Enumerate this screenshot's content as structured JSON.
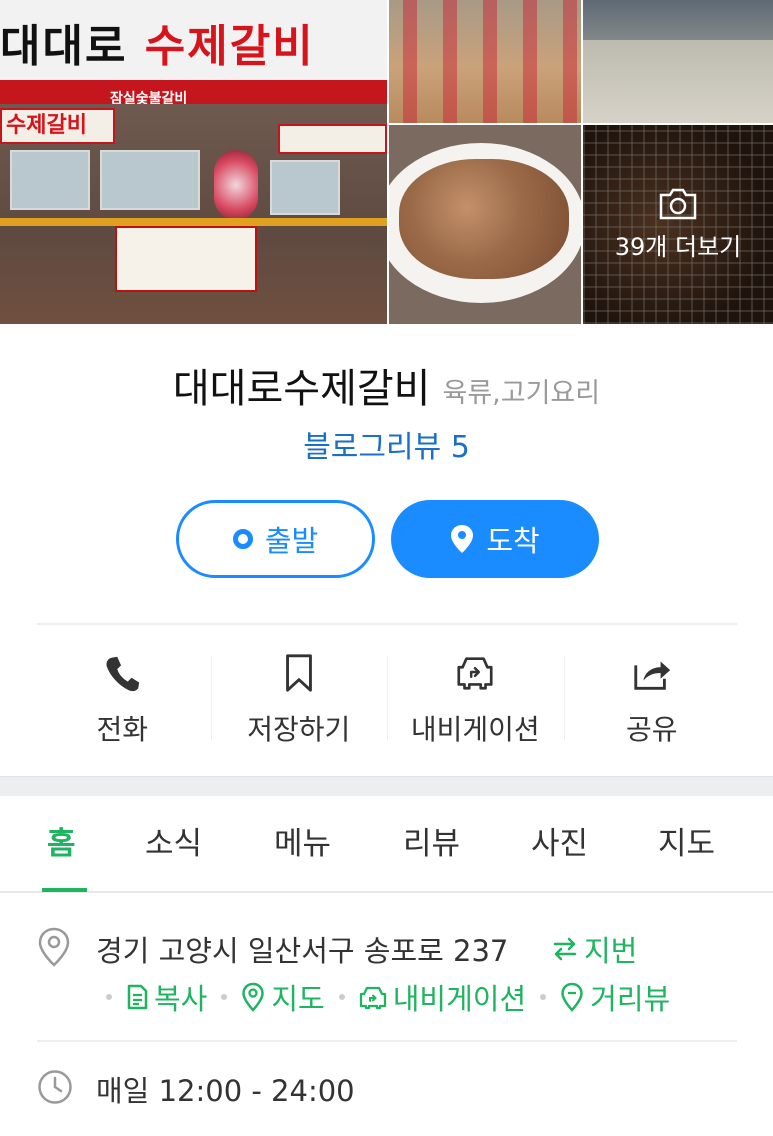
{
  "photos": {
    "main_sign_text_black": "대대로 ",
    "main_sign_text_red": "수제갈비",
    "band_text": "잠실숯불갈비",
    "side_sign_text": "수제갈비",
    "more_label": "39개 더보기"
  },
  "place": {
    "name": "대대로수제갈비",
    "category": "육류,고기요리",
    "blog_review": "블로그리뷰 5"
  },
  "buttons": {
    "start": "출발",
    "arrive": "도착"
  },
  "actions": [
    {
      "label": "전화",
      "icon": "phone-icon"
    },
    {
      "label": "저장하기",
      "icon": "bookmark-icon"
    },
    {
      "label": "내비게이션",
      "icon": "navigation-car-icon"
    },
    {
      "label": "공유",
      "icon": "share-icon"
    }
  ],
  "tabs": [
    "홈",
    "소식",
    "메뉴",
    "리뷰",
    "사진",
    "지도"
  ],
  "active_tab": "홈",
  "info": {
    "address": "경기 고양시 일산서구 송포로 237",
    "jibun": "지번",
    "links": {
      "copy": "복사",
      "map": "지도",
      "navigation": "내비게이션",
      "street_view": "거리뷰"
    },
    "hours": "매일 12:00 - 24:00"
  },
  "colors": {
    "primary_blue": "#1a8cff",
    "link_blue": "#1a6fc9",
    "accent_green": "#1fb45f",
    "muted_gray": "#9a9a9a"
  }
}
